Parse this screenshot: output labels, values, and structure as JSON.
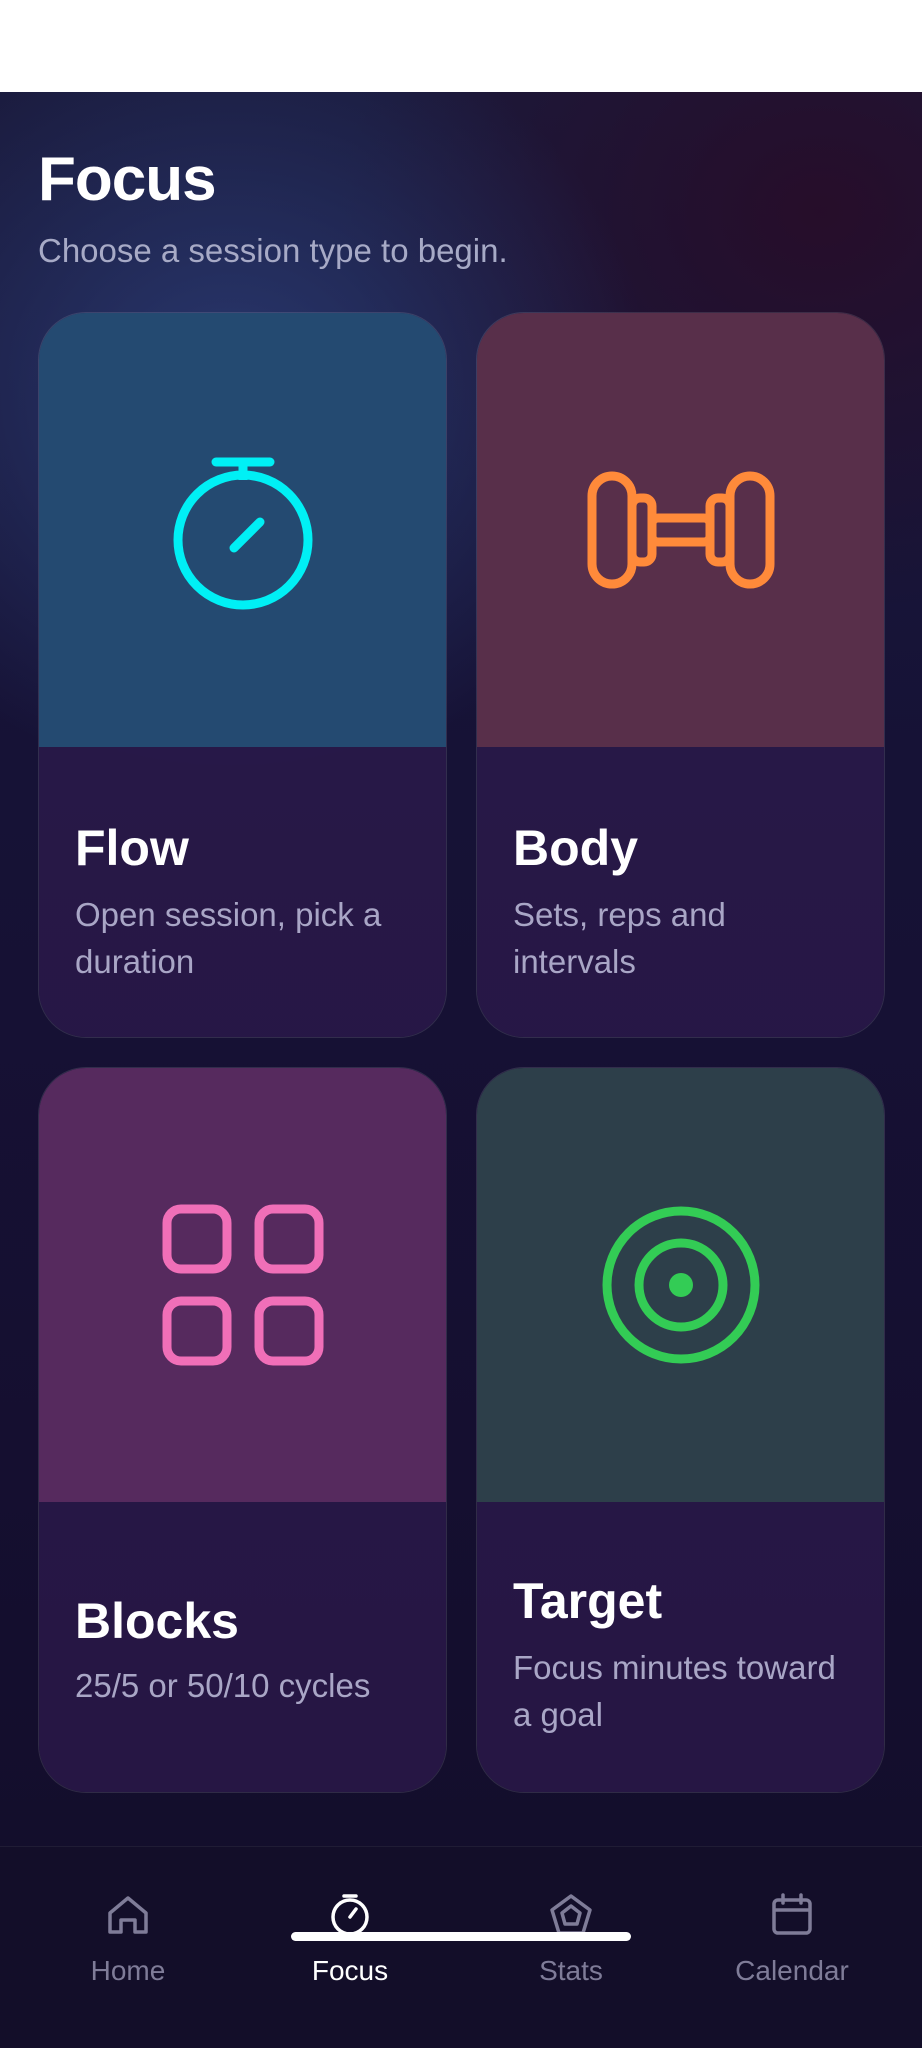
{
  "page": {
    "title": "Focus",
    "subtitle": "Choose a session type to begin."
  },
  "cards": [
    {
      "title": "Flow",
      "description": "Open session, pick a duration",
      "icon": "stopwatch-icon",
      "accent": "#00f0f5"
    },
    {
      "title": "Body",
      "description": "Sets, reps and intervals",
      "icon": "dumbbell-icon",
      "accent": "#ff8a3a"
    },
    {
      "title": "Blocks",
      "description": "25/5 or 50/10 cycles",
      "icon": "grid-icon",
      "accent": "#f06fb8"
    },
    {
      "title": "Target",
      "description": "Focus minutes toward a goal",
      "icon": "target-icon",
      "accent": "#33cc55"
    }
  ],
  "tabbar": {
    "items": [
      {
        "label": "Home",
        "icon": "home-icon"
      },
      {
        "label": "Focus",
        "icon": "stopwatch-icon",
        "active": true
      },
      {
        "label": "Stats",
        "icon": "pentagon-icon"
      },
      {
        "label": "Calendar",
        "icon": "calendar-icon"
      }
    ]
  },
  "colors": {
    "background": "#161236",
    "tab_active": "#ffffff",
    "tab_inactive": "#7f7c98"
  }
}
